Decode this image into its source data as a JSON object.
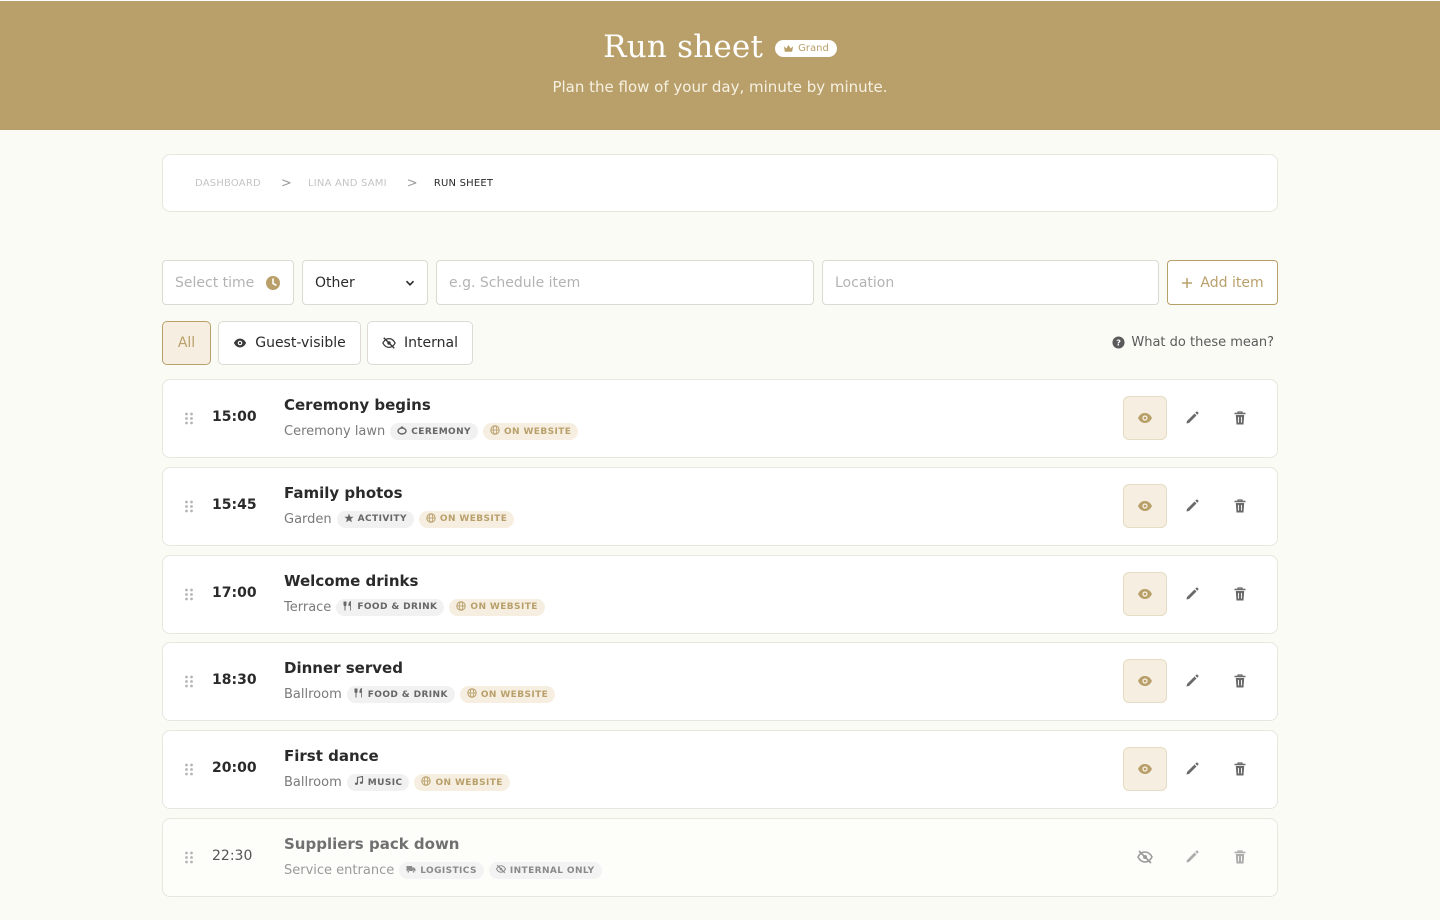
{
  "header": {
    "title": "Run sheet",
    "tier_badge": "Grand",
    "subtitle": "Plan the flow of your day, minute by minute."
  },
  "breadcrumb": [
    "DASHBOARD",
    "LINA AND SAMI",
    "RUN SHEET"
  ],
  "breadcrumb_separator": ">",
  "form": {
    "time_placeholder": "Select time",
    "category_selected": "Other",
    "name_placeholder": "e.g. Schedule item",
    "location_placeholder": "Location",
    "add_label": "Add item"
  },
  "filters": {
    "all": "All",
    "guest_visible": "Guest-visible",
    "internal": "Internal",
    "help": "What do these mean?"
  },
  "items": [
    {
      "time": "15:00",
      "title": "Ceremony begins",
      "location": "Ceremony lawn",
      "category": "CEREMONY",
      "category_icon": "ring-icon",
      "visibility": "ON WEBSITE",
      "guest_visible": true
    },
    {
      "time": "15:45",
      "title": "Family photos",
      "location": "Garden",
      "category": "ACTIVITY",
      "category_icon": "star-icon",
      "visibility": "ON WEBSITE",
      "guest_visible": true
    },
    {
      "time": "17:00",
      "title": "Welcome drinks",
      "location": "Terrace",
      "category": "FOOD & DRINK",
      "category_icon": "utensils-icon",
      "visibility": "ON WEBSITE",
      "guest_visible": true
    },
    {
      "time": "18:30",
      "title": "Dinner served",
      "location": "Ballroom",
      "category": "FOOD & DRINK",
      "category_icon": "utensils-icon",
      "visibility": "ON WEBSITE",
      "guest_visible": true
    },
    {
      "time": "20:00",
      "title": "First dance",
      "location": "Ballroom",
      "category": "MUSIC",
      "category_icon": "music-note-icon",
      "visibility": "ON WEBSITE",
      "guest_visible": true
    },
    {
      "time": "22:30",
      "title": "Suppliers pack down",
      "location": "Service entrance",
      "category": "LOGISTICS",
      "category_icon": "truck-icon",
      "visibility": "INTERNAL ONLY",
      "guest_visible": false
    }
  ],
  "colors": {
    "accent": "#b9a06b",
    "accent_light": "#f6efe1",
    "background": "#fbfbf6",
    "text": "#2a2a2a"
  }
}
